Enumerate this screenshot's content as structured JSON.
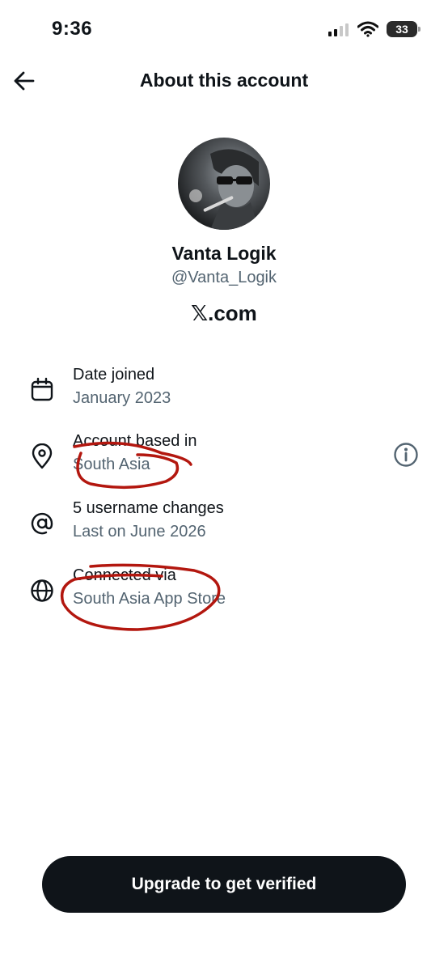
{
  "status_bar": {
    "time": "9:36",
    "battery": "33",
    "icons": [
      "cellular-signal-icon",
      "wifi-icon",
      "battery-icon"
    ]
  },
  "header": {
    "back_icon": "arrow-left-icon",
    "title": "About this account"
  },
  "profile": {
    "name": "Vanta Logik",
    "handle": "@Vanta_Logik",
    "site": "𝕏.com"
  },
  "info_rows": [
    {
      "icon": "calendar-icon",
      "title": "Date joined",
      "value": "January 2023"
    },
    {
      "icon": "location-pin-icon",
      "title": "Account based in",
      "value": "South Asia",
      "trailing_icon": "info-circle-icon"
    },
    {
      "icon": "at-sign-icon",
      "title": "5 username changes",
      "value": "Last on June 2026"
    },
    {
      "icon": "globe-icon",
      "title": "Connected via",
      "value": "South Asia App Store"
    }
  ],
  "cta": {
    "label": "Upgrade to get verified"
  },
  "colors": {
    "primary_text": "#0f1419",
    "secondary_text": "#536471",
    "button_bg": "#0f1419",
    "annotation_red": "#b3170f"
  }
}
